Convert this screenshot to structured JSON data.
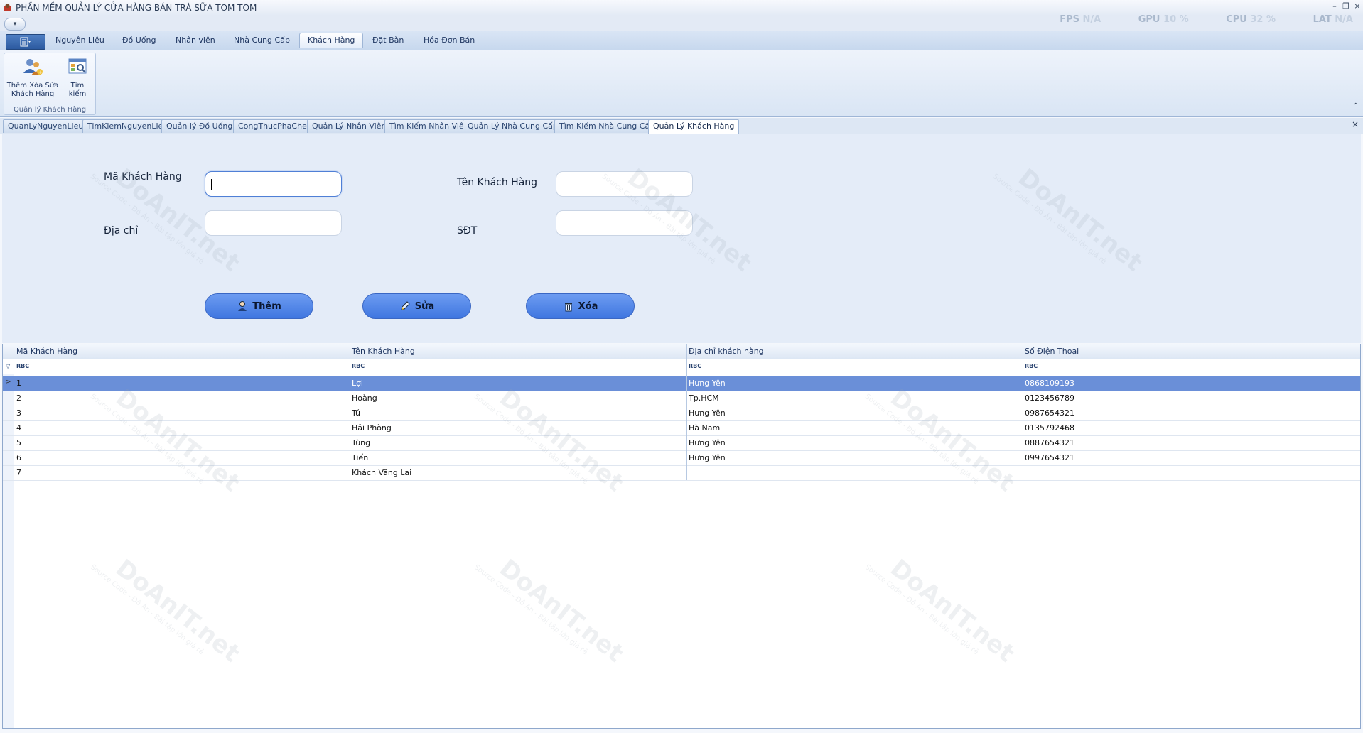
{
  "window": {
    "title": "PHẦN MỀM QUẢN LÝ CỬA HÀNG BÁN TRÀ SỮA TOM TOM",
    "controls": [
      "–",
      "❐",
      "×"
    ]
  },
  "quick_access": {
    "label": "▾"
  },
  "perf_stats": {
    "fps_label": "FPS",
    "fps_value": "N/A",
    "gpu_label": "GPU",
    "gpu_value": "10 %",
    "cpu_label": "CPU",
    "cpu_value": "32 %",
    "lat_label": "LAT",
    "lat_value": "N/A"
  },
  "ribbon": {
    "app_menu_icon": "app-menu-icon",
    "tabs": [
      "Nguyên Liệu",
      "Đồ Uống",
      "Nhân viên",
      "Nhà Cung Cấp",
      "Khách Hàng",
      "Đặt Bàn",
      "Hóa Đơn Bán"
    ],
    "active_tab": "Khách Hàng",
    "group": {
      "label": "Quản lý Khách Hàng",
      "buttons": [
        {
          "label": "Thêm Xóa Sửa Khách Hàng",
          "icon": "customers-icon"
        },
        {
          "label": "Tìm kiếm",
          "icon": "search-window-icon"
        }
      ]
    },
    "collapse_icon": "⌃"
  },
  "doc_tabs": {
    "items": [
      "QuanLyNguyenLieu",
      "TimKiemNguyenLieu",
      "Quản lý Đồ Uống",
      "CongThucPhaChe",
      "Quản Lý Nhân Viên",
      "Tìm Kiếm Nhân Viên",
      "Quản Lý Nhà Cung Cấp",
      "Tìm Kiếm Nhà Cung Cấp",
      "Quản Lý Khách Hàng"
    ],
    "active": "Quản Lý Khách Hàng",
    "close": "×"
  },
  "form": {
    "ma_kh_label": "Mã Khách Hàng",
    "ma_kh_value": "",
    "ten_kh_label": "Tên Khách Hàng",
    "ten_kh_value": "",
    "dia_chi_label": "Địa chỉ",
    "dia_chi_value": "",
    "sdt_label": "SĐT",
    "sdt_value": "",
    "btn_them": "Thêm",
    "btn_sua": "Sửa",
    "btn_xoa": "Xóa"
  },
  "grid": {
    "columns": [
      "Mã Khách Hàng",
      "Tên Khách Hàng",
      "Địa chỉ khách hàng",
      "Số Điện Thoại"
    ],
    "filter_icon": "RBC",
    "rows": [
      [
        "1",
        "Lợi",
        "Hưng Yên",
        "0868109193"
      ],
      [
        "2",
        "Hoàng",
        "Tp.HCM",
        "0123456789"
      ],
      [
        "3",
        "Tú",
        "Hưng Yên",
        "0987654321"
      ],
      [
        "4",
        "Hải Phòng",
        "Hà Nam",
        "0135792468"
      ],
      [
        "5",
        "Tùng",
        "Hưng Yên",
        "0887654321"
      ],
      [
        "6",
        "Tiến",
        "Hưng Yên",
        "0997654321"
      ],
      [
        "7",
        "Khách Vãng Lai",
        "",
        ""
      ]
    ],
    "selected_row": 0
  },
  "watermark": {
    "brand": "DoAnIT.net",
    "tagline": "Source Code - Đồ Án - Bài tập lớn giá rẻ"
  },
  "colors": {
    "accent": "#4f7fe0",
    "selection": "#6a8fd8",
    "ribbon": "#d9e5f5",
    "form_bg": "#e4ecf8"
  }
}
